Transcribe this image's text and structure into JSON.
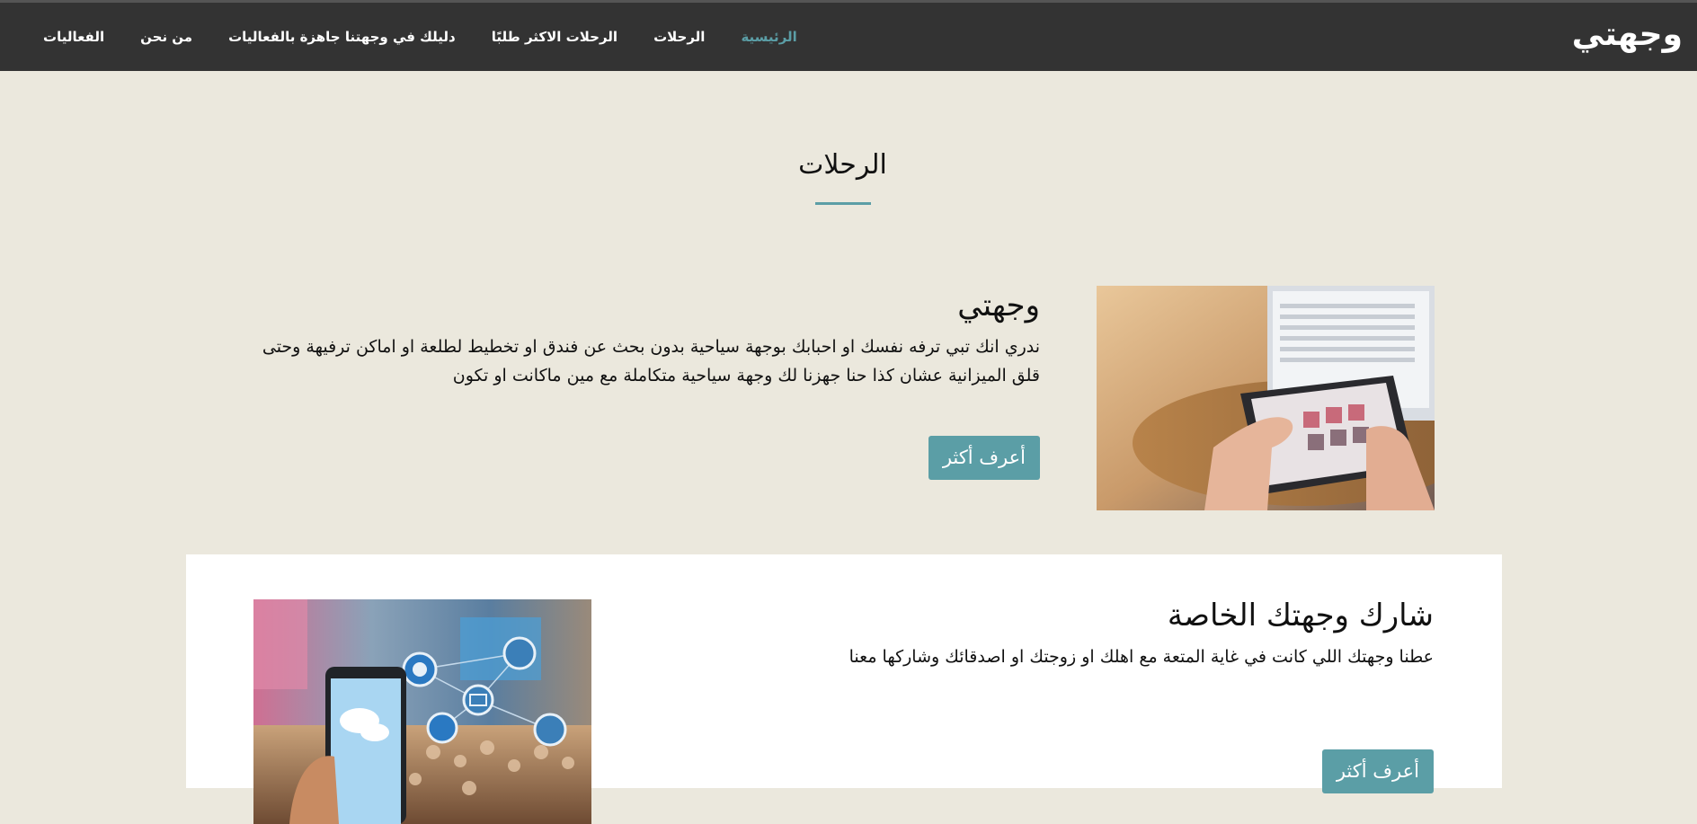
{
  "navbar": {
    "brand": "وجهتي",
    "links": [
      {
        "label": "الرئيسية",
        "active": true
      },
      {
        "label": "الرحلات",
        "active": false
      },
      {
        "label": "الرحلات الاكثر طلبًا",
        "active": false
      },
      {
        "label": "دليلك في وجهتنا جاهزة بالفعاليات",
        "active": false
      },
      {
        "label": "من نحن",
        "active": false
      },
      {
        "label": "الفعاليات",
        "active": false
      }
    ]
  },
  "section": {
    "title": "الرحلات"
  },
  "features": [
    {
      "heading": "وجهتي",
      "body": "ندري انك تبي ترفه نفسك او احبابك بوجهة سياحية بدون بحث عن فندق او تخطيط لطلعة او اماكن ترفيهة وحتى قلق الميزانية عشان كذا حنا جهزنا لك وجهة سياحية متكاملة مع مين ماكانت او تكون",
      "button": "أعرف أكثر",
      "image": "tablet-photo"
    },
    {
      "heading": "شارك وجهتك الخاصة",
      "body": "عطنا وجهتك اللي كانت في غاية المتعة مع اهلك او زوجتك او اصدقائك وشاركها معنا",
      "button": "أعرف أكثر",
      "image": "social-phone-photo"
    }
  ],
  "colors": {
    "navbar_bg": "#333333",
    "accent": "#5b9ea6",
    "page_bg": "#ebe8dd",
    "card_bg": "#ffffff"
  }
}
